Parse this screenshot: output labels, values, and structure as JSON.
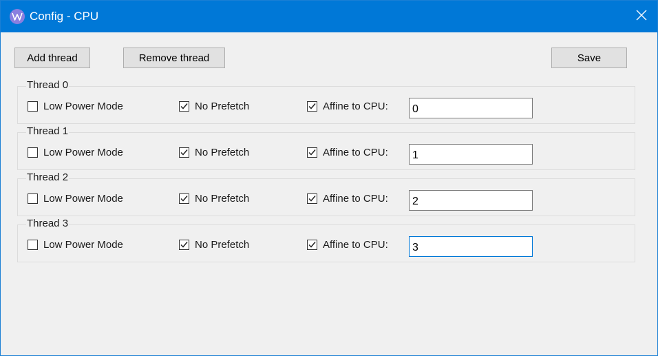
{
  "window": {
    "title": "Config - CPU",
    "app_icon": "w-logo-icon",
    "close_icon": "close-icon",
    "accent": "#0078d7"
  },
  "toolbar": {
    "add_label": "Add thread",
    "remove_label": "Remove thread",
    "save_label": "Save"
  },
  "threads": [
    {
      "title": "Thread 0",
      "low_power_label": "Low Power Mode",
      "low_power": false,
      "no_prefetch_label": "No Prefetch",
      "no_prefetch": true,
      "affine_label": "Affine to CPU:",
      "affine": true,
      "cpu": "0"
    },
    {
      "title": "Thread 1",
      "low_power_label": "Low Power Mode",
      "low_power": false,
      "no_prefetch_label": "No Prefetch",
      "no_prefetch": true,
      "affine_label": "Affine to CPU:",
      "affine": true,
      "cpu": "1"
    },
    {
      "title": "Thread 2",
      "low_power_label": "Low Power Mode",
      "low_power": false,
      "no_prefetch_label": "No Prefetch",
      "no_prefetch": true,
      "affine_label": "Affine to CPU:",
      "affine": true,
      "cpu": "2"
    },
    {
      "title": "Thread 3",
      "low_power_label": "Low Power Mode",
      "low_power": false,
      "no_prefetch_label": "No Prefetch",
      "no_prefetch": true,
      "affine_label": "Affine to CPU:",
      "affine": true,
      "cpu": "3",
      "focused": true
    }
  ]
}
